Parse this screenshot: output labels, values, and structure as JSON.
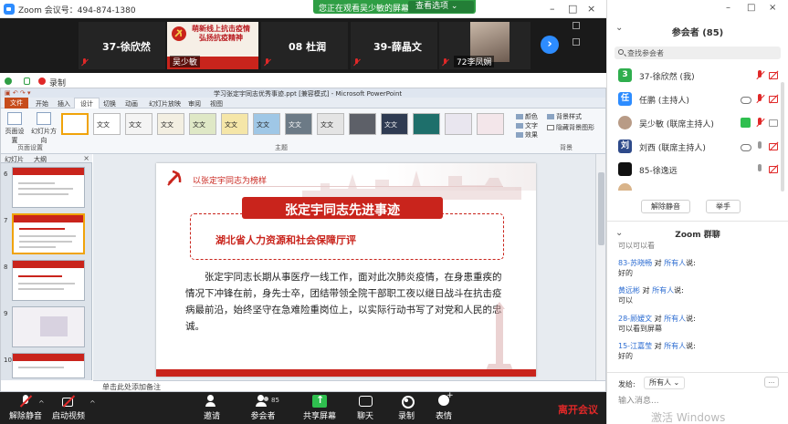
{
  "window": {
    "title": "Zoom 会议号：494-874-1380",
    "viewing_banner": "您正在观看吴少敏的屏幕",
    "view_options": "查看选项"
  },
  "video_strip": {
    "tiles": [
      {
        "name": "37-徐欣然"
      },
      {
        "name": "吴少敏",
        "promo_text": "萌新线上抗击疫情 弘扬抗疫精神"
      },
      {
        "name": "08 杜润"
      },
      {
        "name": "39-薛晶文"
      },
      {
        "name": "72李凤娴"
      }
    ]
  },
  "recording": {
    "label": "录制"
  },
  "powerpoint": {
    "title": "学习张定宇同志优秀事迹.ppt [兼容模式] - Microsoft PowerPoint",
    "tabs": [
      "文件",
      "开始",
      "插入",
      "设计",
      "切换",
      "动画",
      "幻灯片放映",
      "审阅",
      "视图"
    ],
    "active_tab": "设计",
    "ribbon": {
      "page_setup": "页面设置",
      "orientation": "幻灯片方向",
      "group_page_setup": "页面设置",
      "group_themes": "主题",
      "group_background": "背景",
      "colors": "颜色",
      "fonts": "文字",
      "effects": "效果",
      "bg_styles": "背景样式",
      "hide_bg": "隐藏背景图形",
      "theme_labels": [
        "文文",
        "文文",
        "文文",
        "文文",
        "文文",
        "文文",
        "文文",
        "文文",
        "文文"
      ]
    },
    "thumb_tabs": [
      "幻灯片",
      "大纲"
    ],
    "slide_numbers": [
      "6",
      "7",
      "8",
      "9",
      "10"
    ],
    "notes_placeholder": "单击此处添加备注"
  },
  "slide": {
    "header": "以张定宇同志为榜样",
    "title": "张定宇同志先进事迹",
    "subtitle": "湖北省人力资源和社会保障厅评",
    "body": "张定宇同志长期从事医疗一线工作，面对此次肺炎疫情，在身患重疾的情况下冲锋在前，身先士卒，团结带领全院干部职工夜以继日战斗在抗击疫病最前沿，始终坚守在急难险重岗位上，以实际行动书写了对党和人民的忠诚。"
  },
  "toolbar": {
    "unmute": "解除静音",
    "start_video": "启动视频",
    "invite": "邀请",
    "participants": "参会者",
    "participants_count": "85",
    "share": "共享屏幕",
    "chat": "聊天",
    "record": "录制",
    "reactions": "表情",
    "leave": "离开会议"
  },
  "panel": {
    "title": "参会者 (85)",
    "search_placeholder": "查找参会者",
    "participants": [
      {
        "initial": "3",
        "name": "37-徐欣然 (我)",
        "color": "#2fae4e"
      },
      {
        "initial": "任",
        "name": "任鹏 (主持人)",
        "color": "#2d8cff"
      },
      {
        "initial": "",
        "name": "吴少敏 (联席主持人)",
        "color": "#b89b86"
      },
      {
        "initial": "刘",
        "name": "刘西 (联席主持人)",
        "color": "#2e4a8a"
      },
      {
        "initial": "",
        "name": "85-徐逸远",
        "color": "#111111"
      },
      {
        "initial": "",
        "name": "...",
        "color": "#d9b48a"
      }
    ],
    "unmute_all": "解除静音",
    "raise_hand": "举手",
    "chat_title": "Zoom 群聊",
    "chat_top_partial": "可以可以看",
    "messages": [
      {
        "from": "83-苏晓畅",
        "to": "所有人",
        "said": "说:",
        "text": "好的"
      },
      {
        "from": "黄远彬",
        "to": "所有人",
        "said": "说:",
        "text": "可以"
      },
      {
        "from": "28-顾嫒文",
        "to": "所有人",
        "said": "说:",
        "text": "可以看到屏幕"
      },
      {
        "from": "15-江嘉莹",
        "to": "所有人",
        "said": "说:",
        "text": "好的"
      }
    ],
    "send_to_label": "发给:",
    "send_to_value": "所有人",
    "input_placeholder": "输入消息...",
    "more": "...",
    "watermark": "激活 Windows"
  }
}
